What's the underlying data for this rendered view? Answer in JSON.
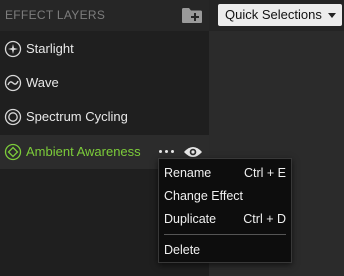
{
  "header": {
    "title": "EFFECT LAYERS",
    "add_folder_icon": "folder-add-icon"
  },
  "quick_selections": {
    "selected": "Quick Selections"
  },
  "layers": [
    {
      "label": "Starlight",
      "icon": "starlight-icon"
    },
    {
      "label": "Wave",
      "icon": "wave-icon"
    },
    {
      "label": "Spectrum Cycling",
      "icon": "spectrum-cycling-icon"
    },
    {
      "label": "Ambient Awareness",
      "icon": "ambient-awareness-icon",
      "selected": true
    }
  ],
  "selected_layer_actions": {
    "more_icon": "more-options-icon",
    "visibility_icon": "eye-icon"
  },
  "context_menu": {
    "items": [
      {
        "label": "Rename",
        "shortcut": "Ctrl + E"
      },
      {
        "label": "Change Effect",
        "shortcut": ""
      },
      {
        "label": "Duplicate",
        "shortcut": "Ctrl + D"
      },
      {
        "label": "Delete",
        "shortcut": ""
      }
    ]
  },
  "colors": {
    "accent": "#7ccc3a",
    "panel_bg": "#1f1f1f",
    "menu_bg": "#0d0d0d"
  }
}
